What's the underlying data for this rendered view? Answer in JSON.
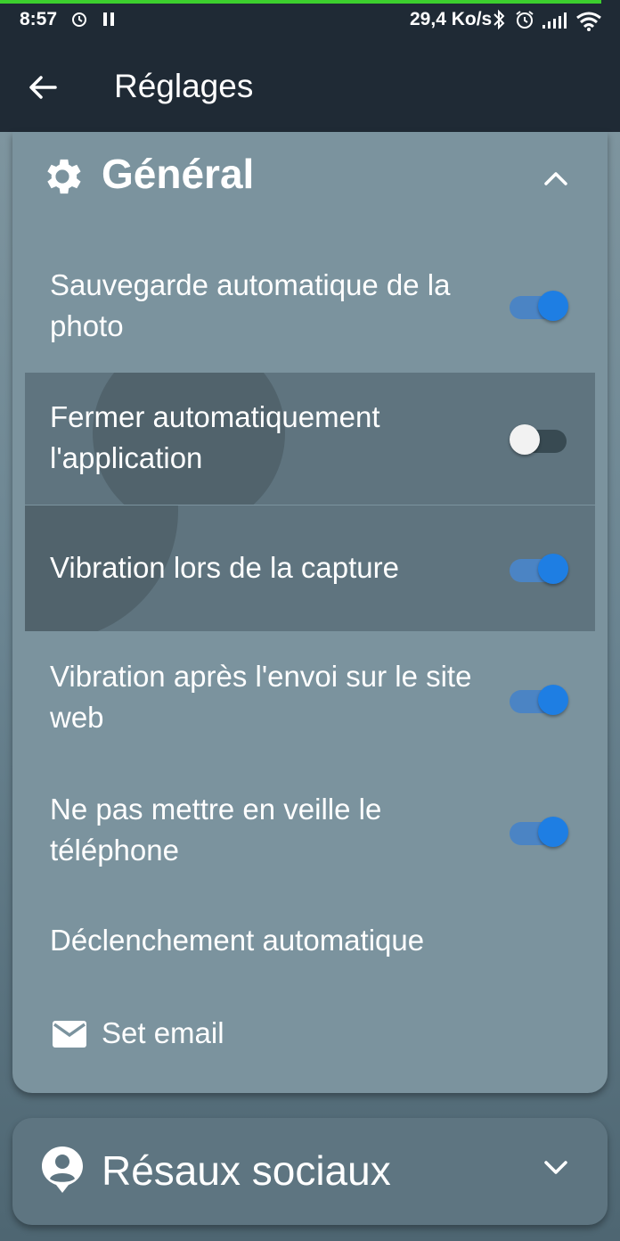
{
  "status_bar": {
    "time": "8:57",
    "net_speed": "29,4 Ko/s",
    "icons": [
      "alarm-icon",
      "pause-icon",
      "bluetooth-icon",
      "alarm-clock-icon",
      "signal-icon",
      "wifi-icon"
    ]
  },
  "app_bar": {
    "title": "Réglages",
    "back_icon": "arrow-left-icon"
  },
  "general_section": {
    "title": "Général",
    "icon": "gear-icon",
    "expanded": true,
    "settings": [
      {
        "label": "Sauvegarde automatique de la photo",
        "enabled": true
      },
      {
        "label": "Fermer automatiquement l'application",
        "enabled": false
      },
      {
        "label": "Vibration lors de la capture",
        "enabled": true
      },
      {
        "label": "Vibration après l'envoi sur le site web",
        "enabled": true
      },
      {
        "label": "Ne pas mettre en veille le téléphone",
        "enabled": true
      }
    ],
    "auto_trigger_label": "Déclenchement automatique",
    "set_email_label": "Set email"
  },
  "social_section": {
    "title": "Résaux sociaux",
    "icon": "account-pin-icon",
    "expanded": false
  },
  "colors": {
    "toggle_on": "#1e7ee3",
    "app_bar": "#1f2a35",
    "card": "#7b939e"
  }
}
